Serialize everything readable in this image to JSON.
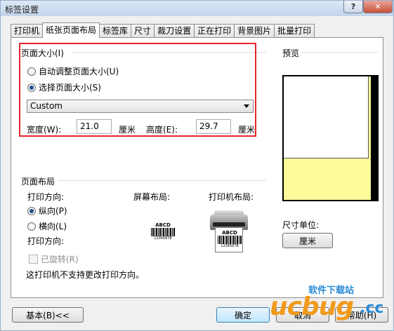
{
  "window": {
    "title": "标签设置",
    "help_glyph": "?",
    "close_glyph": "✕"
  },
  "tabs": [
    {
      "label": "打印机",
      "active": false
    },
    {
      "label": "纸张页面布局",
      "active": true
    },
    {
      "label": "标签库",
      "active": false
    },
    {
      "label": "尺寸",
      "active": false
    },
    {
      "label": "裁刀设置",
      "active": false
    },
    {
      "label": "正在打印",
      "active": false
    },
    {
      "label": "背景图片",
      "active": false
    },
    {
      "label": "批量打印",
      "active": false
    }
  ],
  "page_size": {
    "group_label": "页面大小(I)",
    "auto_radio": "自动调整页面大小(U)",
    "select_radio": "选择页面大小(S)",
    "selected_radio": "select",
    "dropdown_value": "Custom",
    "width_label": "宽度(W):",
    "width_value": "21.0",
    "width_unit": "厘米",
    "height_label": "高度(E):",
    "height_value": "29.7",
    "height_unit": "厘米"
  },
  "preview": {
    "label": "预览",
    "unit_label": "尺寸单位:",
    "unit_button": "厘米",
    "colors": {
      "page": "#fdfb9a",
      "label": "#ffffff",
      "frame": "#000000"
    }
  },
  "layout": {
    "group_label": "页面布局",
    "orientation_label": "打印方向:",
    "portrait": "纵向(P)",
    "landscape": "横向(L)",
    "selected": "portrait",
    "screen_layout_label": "屏幕布局:",
    "printer_layout_label": "打印机布局:",
    "print_direction_label": "打印方向:",
    "rotated_checkbox": "已旋转(R)",
    "note": "这打印机不支持更改打印方向。"
  },
  "barcode": {
    "caption": "ABCD",
    "digits": "12345678"
  },
  "footer": {
    "basic_button": "基本(B)<<",
    "ok_button": "确定",
    "cancel_button": "取消",
    "help_button": "帮助(H)"
  },
  "watermark": {
    "site": "软件下载站",
    "logo": "ucbug",
    "tld": ".cc"
  }
}
